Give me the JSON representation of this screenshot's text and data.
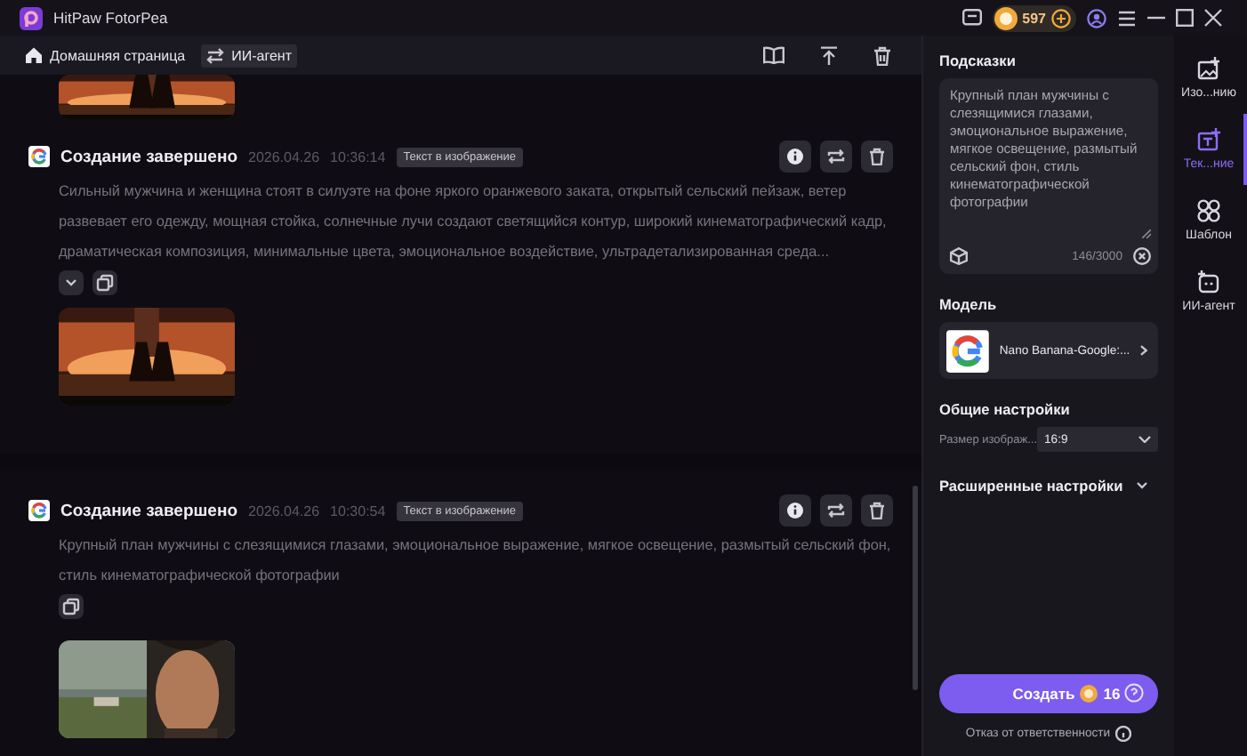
{
  "window": {
    "title": "HitPaw FotorPea",
    "credits": "597"
  },
  "toolbar": {
    "home": "Домашняя страница",
    "agent": "ИИ-агент"
  },
  "results": [
    {
      "status": "Создание завершено",
      "date": "2026.04.26",
      "time": "10:36:14",
      "tag": "Текст в изображение",
      "prompt": "Сильный мужчина и женщина стоят в силуэте на фоне яркого оранжевого заката, открытый сельский пейзаж, ветер развевает его одежду, мощная стойка, солнечные лучи создают светящийся контур, широкий кинематографический кадр, драматическая композиция, минимальные цвета, эмоциональное воздействие, ультрадетализированная среда...",
      "collapsed": true
    },
    {
      "status": "Создание завершено",
      "date": "2026.04.26",
      "time": "10:30:54",
      "tag": "Текст в изображение",
      "prompt": "Крупный план мужчины с слезящимися глазами, эмоциональное выражение, мягкое освещение, размытый сельский фон, стиль кинематографической фотографии",
      "collapsed": false
    }
  ],
  "panel": {
    "prompt_label": "Подсказки",
    "prompt": "Крупный план мужчины с слезящимися глазами, эмоциональное выражение, мягкое освещение, размытый сельский фон, стиль кинематографической фотографии",
    "counter": "146/3000",
    "model_label": "Модель",
    "model": "Nano Banana-Google:...",
    "general_label": "Общие настройки",
    "size_label": "Размер изображ...",
    "size_value": "16:9",
    "advanced_label": "Расширенные настройки",
    "create": "Создать",
    "cost": "16",
    "disclaimer": "Отказ от ответственности"
  },
  "nav": [
    {
      "label": "Изо...нию",
      "selected": false
    },
    {
      "label": "Тек...ние",
      "selected": true
    },
    {
      "label": "Шаблон",
      "selected": false
    },
    {
      "label": "ИИ-агент",
      "selected": false
    }
  ]
}
